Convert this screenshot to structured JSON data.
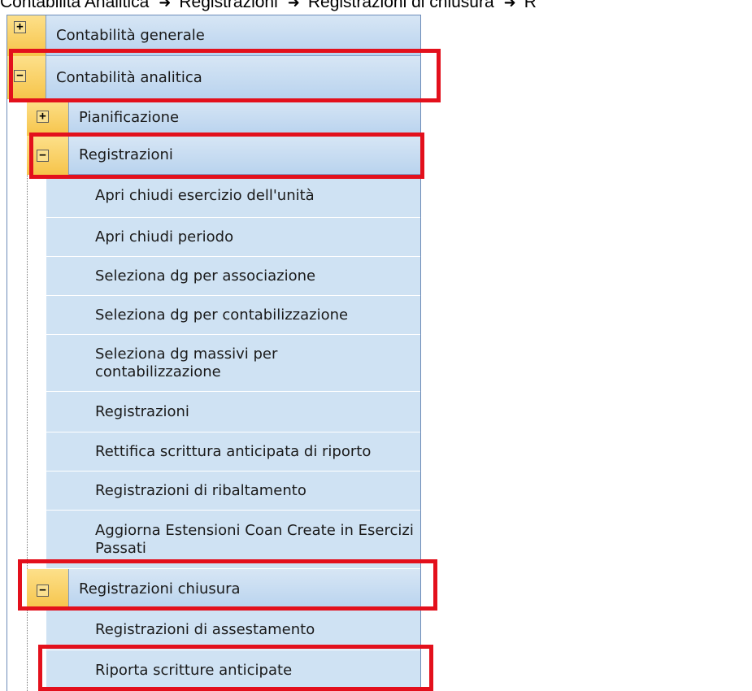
{
  "breadcrumb": {
    "items": [
      "Contabilità Analitica",
      "Registrazioni",
      "Registrazioni di chiusura",
      "R"
    ],
    "separator": "➜"
  },
  "tree": {
    "contabilita_generale": {
      "label": "Contabilità generale",
      "toggle": "+"
    },
    "contabilita_analitica": {
      "label": "Contabilità analitica",
      "toggle": "−"
    },
    "pianificazione": {
      "label": "Pianificazione",
      "toggle": "+"
    },
    "registrazioni": {
      "label": "Registrazioni",
      "toggle": "−",
      "items": [
        "Apri chiudi esercizio dell'unità",
        "Apri chiudi periodo",
        "Seleziona dg per associazione",
        "Seleziona dg per contabilizzazione",
        "Seleziona dg massivi per contabilizzazione",
        "Registrazioni",
        "Rettifica scrittura anticipata di riporto",
        "Registrazioni di ribaltamento",
        "Aggiorna Estensioni Coan Create in Esercizi Passati"
      ]
    },
    "registrazioni_chiusura": {
      "label": "Registrazioni chiusura",
      "toggle": "−",
      "items": [
        "Registrazioni di assestamento",
        "Riporta scritture anticipate"
      ]
    }
  },
  "colors": {
    "highlight": "#e3101c",
    "header_bg": "#b9d3ee",
    "item_bg": "#cfe2f3",
    "toggle_bg": "#f6c44a"
  }
}
